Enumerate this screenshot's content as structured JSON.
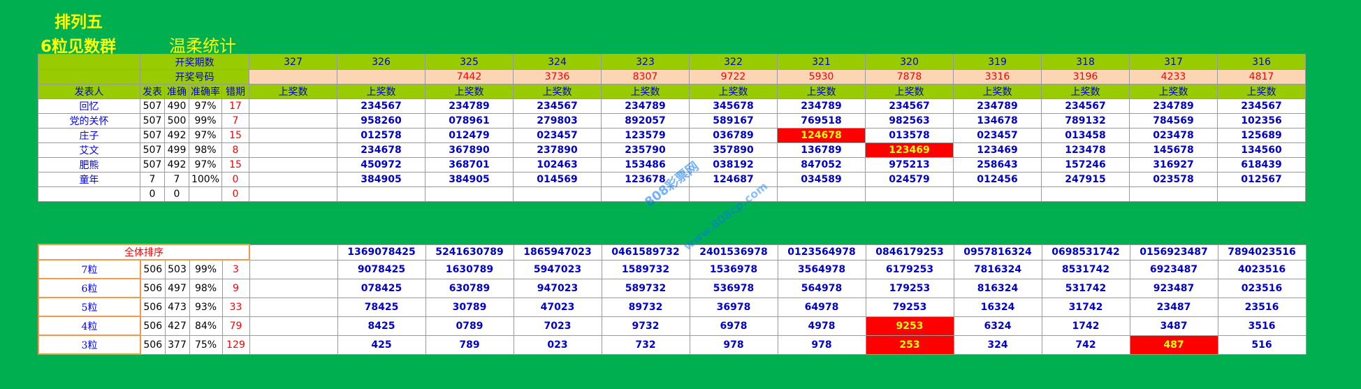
{
  "title_line1": "排列五",
  "title_line2": "6粒见数群",
  "title_side": "温柔统计",
  "header": {
    "period_label": "开奖期数",
    "code_label": "开奖号码",
    "presenter_label": "发表人",
    "col_publish": "发表",
    "col_correct": "准确",
    "col_rate": "准确率",
    "col_miss": "错期",
    "prize_label": "上奖数"
  },
  "periods": [
    "327",
    "326",
    "325",
    "324",
    "323",
    "322",
    "321",
    "320",
    "319",
    "318",
    "317",
    "316"
  ],
  "codes": [
    "",
    "",
    "7442",
    "3736",
    "8307",
    "9722",
    "5930",
    "7878",
    "3316",
    "3196",
    "4233",
    "4817"
  ],
  "presenters": [
    {
      "name": "回忆",
      "publish": "507",
      "correct": "490",
      "rate": "97%",
      "miss": "17",
      "cells": [
        "",
        "234567",
        "234789",
        "234567",
        "234789",
        "345678",
        "234789",
        "234567",
        "234789",
        "234567",
        "234789",
        "234567"
      ]
    },
    {
      "name": "党的关怀",
      "publish": "507",
      "correct": "500",
      "rate": "99%",
      "miss": "7",
      "cells": [
        "",
        "958260",
        "078961",
        "279803",
        "892057",
        "589167",
        "769518",
        "982563",
        "134678",
        "789132",
        "784569",
        "102356"
      ]
    },
    {
      "name": "庄子",
      "publish": "507",
      "correct": "492",
      "rate": "97%",
      "miss": "15",
      "cells": [
        "",
        "012578",
        "012479",
        "023457",
        "123579",
        "036789",
        "124678",
        "013578",
        "023457",
        "013458",
        "023478",
        "125689"
      ]
    },
    {
      "name": "艾文",
      "publish": "507",
      "correct": "499",
      "rate": "98%",
      "miss": "8",
      "cells": [
        "",
        "234678",
        "367890",
        "237890",
        "235790",
        "357890",
        "136789",
        "123469",
        "123469",
        "123478",
        "145678",
        "134560"
      ]
    },
    {
      "name": "肥熊",
      "publish": "507",
      "correct": "492",
      "rate": "97%",
      "miss": "15",
      "cells": [
        "",
        "450972",
        "368701",
        "102463",
        "153486",
        "038192",
        "847052",
        "975213",
        "258643",
        "157246",
        "316927",
        "618439"
      ]
    },
    {
      "name": "童年",
      "publish": "7",
      "correct": "7",
      "rate": "100%",
      "miss": "0",
      "cells": [
        "",
        "384905",
        "384905",
        "014569",
        "123678",
        "124687",
        "034589",
        "024579",
        "012456",
        "247915",
        "023578",
        "012567"
      ]
    },
    {
      "name": "",
      "publish": "0",
      "correct": "0",
      "rate": "",
      "miss": "0",
      "cells": [
        "",
        "",
        "",
        "",
        "",
        "",
        "",
        "",
        "",
        "",
        "",
        ""
      ]
    }
  ],
  "ranking": {
    "label": "全体排序",
    "full": [
      "",
      "1369078425",
      "5241630789",
      "1865947023",
      "0461589732",
      "2401536978",
      "0123564978",
      "0846179253",
      "0957816324",
      "0698531742",
      "0156923487",
      "7894023516"
    ],
    "rows": [
      {
        "name": "7粒",
        "publish": "506",
        "correct": "503",
        "rate": "99%",
        "miss": "3",
        "cells": [
          "",
          "9078425",
          "1630789",
          "5947023",
          "1589732",
          "1536978",
          "3564978",
          "6179253",
          "7816324",
          "8531742",
          "6923487",
          "4023516"
        ]
      },
      {
        "name": "6粒",
        "publish": "506",
        "correct": "497",
        "rate": "98%",
        "miss": "9",
        "cells": [
          "",
          "078425",
          "630789",
          "947023",
          "589732",
          "536978",
          "564978",
          "179253",
          "816324",
          "531742",
          "923487",
          "023516"
        ]
      },
      {
        "name": "5粒",
        "publish": "506",
        "correct": "473",
        "rate": "93%",
        "miss": "33",
        "cells": [
          "",
          "78425",
          "30789",
          "47023",
          "89732",
          "36978",
          "64978",
          "79253",
          "16324",
          "31742",
          "23487",
          "23516"
        ]
      },
      {
        "name": "4粒",
        "publish": "506",
        "correct": "427",
        "rate": "84%",
        "miss": "79",
        "cells": [
          "",
          "8425",
          "0789",
          "7023",
          "9732",
          "6978",
          "4978",
          "9253",
          "6324",
          "1742",
          "3487",
          "3516"
        ]
      },
      {
        "name": "3粒",
        "publish": "506",
        "correct": "377",
        "rate": "75%",
        "miss": "129",
        "cells": [
          "",
          "425",
          "789",
          "023",
          "732",
          "978",
          "978",
          "253",
          "324",
          "742",
          "487",
          "516"
        ]
      }
    ]
  },
  "watermark": "808彩票网",
  "watermark2": "www.808cp.com",
  "colors": {
    "background": "#00b050",
    "header": "#99cc00",
    "peach": "#fcd5b4",
    "highlight": "#ff0000",
    "title": "#ffff00"
  }
}
